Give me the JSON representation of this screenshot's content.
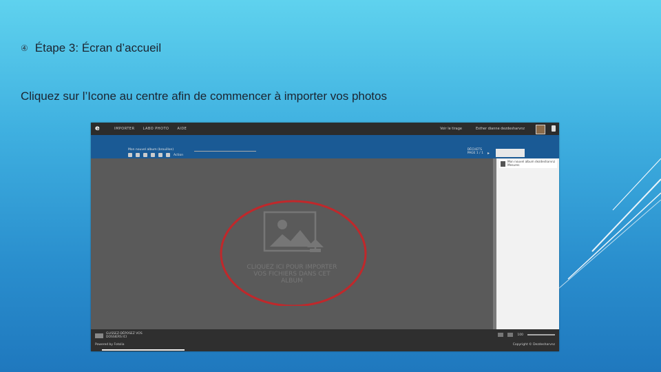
{
  "slide": {
    "title": "Étape 3: Écran d’accueil",
    "body": "Cliquez sur l’Icone au centre afin de commencer à importer vos photos",
    "bullet_icon": "circled-number-icon"
  },
  "app": {
    "nav": [
      "IMPORTER",
      "LABO PHOTO",
      "AIDE"
    ],
    "user": [
      "Voir le tirage",
      "Esther dianne dezdesharvnz"
    ],
    "album_name": "Mon nouvel album (brouillon)",
    "toolbar_text": "Action",
    "right_labels": [
      "DÉCHETS",
      "PAGE 1 / 1"
    ],
    "panel_item": "Mon nouvel album dezdesharvnz Mesures",
    "upload_prompt": [
      "CLIQUEZ ICI POUR IMPORTER",
      "VOS FICHIERS DANS CET",
      "ALBUM"
    ],
    "footer_info": [
      "GLISSEZ-DÉPOSEZ VOS",
      "DOSSIERS ICI"
    ],
    "powered_by": "Powered by Fotolia",
    "copyright": "Copyright © Dezdesharvnz",
    "zoom_label": "100"
  },
  "colors": {
    "accent_blue": "#1a5a95",
    "highlight_ring": "#c0282b"
  }
}
